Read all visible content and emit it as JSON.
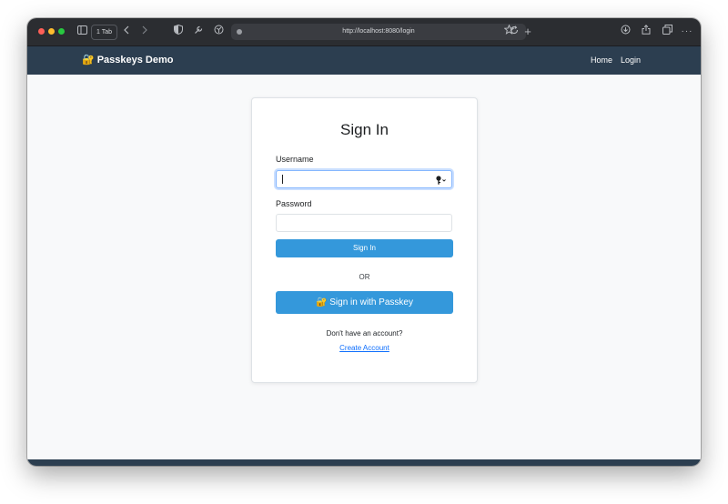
{
  "browser": {
    "tab_count": "1 Tab",
    "url": "http://localhost:8080/login"
  },
  "navbar": {
    "brand_emoji": "🔐",
    "brand": "Passkeys Demo",
    "links": [
      "Home",
      "Login"
    ]
  },
  "login": {
    "title": "Sign In",
    "username_label": "Username",
    "username_value": "",
    "password_label": "Password",
    "password_value": "",
    "signin_button": "Sign In",
    "or_divider": "OR",
    "passkey_button": "🔐 Sign in with Passkey",
    "no_account_text": "Don't have an account?",
    "create_account_link": "Create Account"
  },
  "colors": {
    "navbar": "#2c3e50",
    "primary_button": "#3498db",
    "link": "#0d6efd"
  }
}
